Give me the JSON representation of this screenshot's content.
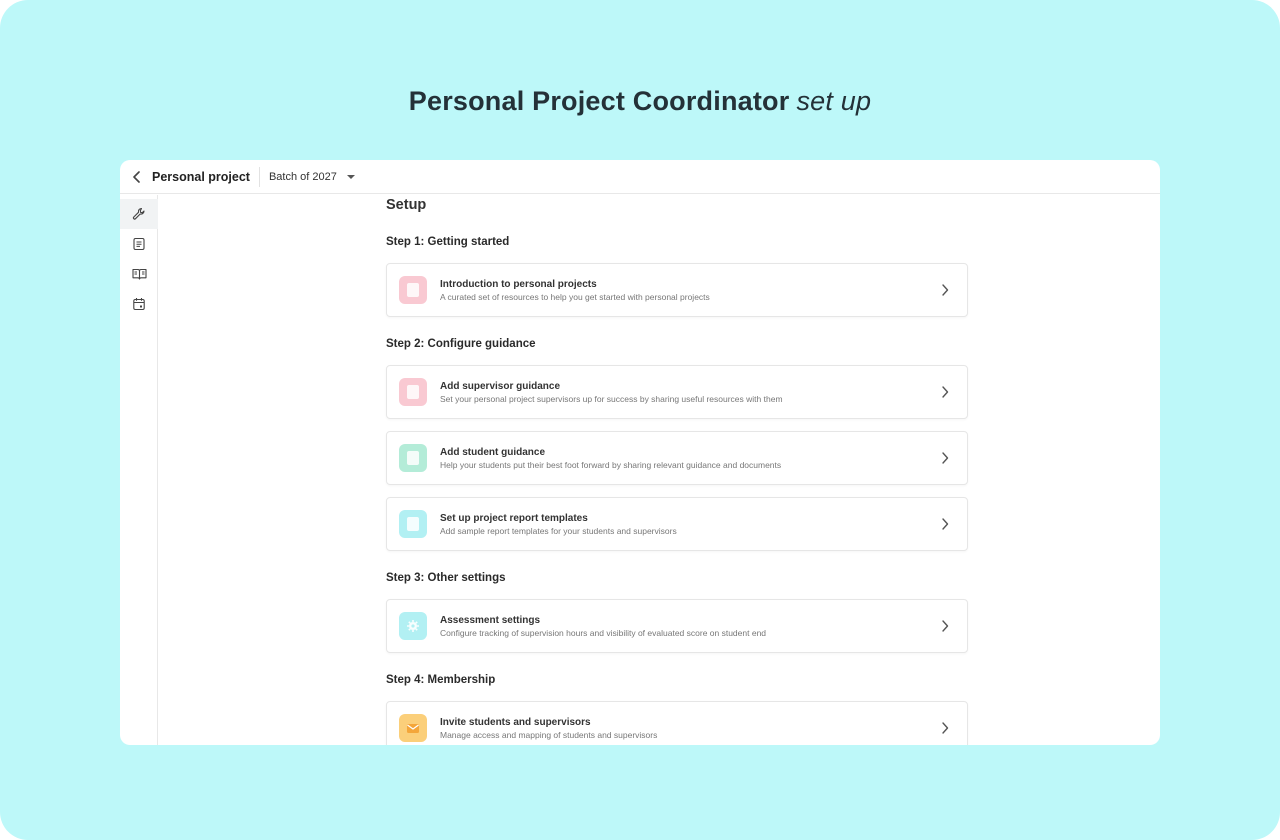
{
  "headline": {
    "strong": "Personal Project Coordinator",
    "soft": "set up"
  },
  "topbar": {
    "title": "Personal project",
    "batch": "Batch of 2027"
  },
  "colors": {
    "background": "#bdf8f9",
    "pink": "#f9c9d2",
    "teal": "#b4ecd8",
    "cyan": "#b2f0f3",
    "orange": "#fbcf7a"
  },
  "sidebar": [
    "wrench-icon",
    "document-list-icon",
    "book-icon",
    "calendar-icon"
  ],
  "setup": {
    "title": "Setup",
    "steps": [
      {
        "title": "Step 1: Getting started",
        "items": [
          {
            "title": "Introduction to personal projects",
            "desc": "A curated set of resources to help you get started with personal projects",
            "icon": "pink-document-icon"
          }
        ]
      },
      {
        "title": "Step 2: Configure guidance",
        "items": [
          {
            "title": "Add supervisor guidance",
            "desc": "Set your personal project supervisors up for success by sharing useful resources with them",
            "icon": "pink-document-icon"
          },
          {
            "title": "Add student guidance",
            "desc": "Help your students put their best foot forward by sharing relevant guidance and documents",
            "icon": "teal-document-icon"
          },
          {
            "title": "Set up project report templates",
            "desc": "Add sample report templates for your students and supervisors",
            "icon": "cyan-document-icon"
          }
        ]
      },
      {
        "title": "Step 3: Other settings",
        "items": [
          {
            "title": "Assessment settings",
            "desc": "Configure tracking of supervision hours and visibility of evaluated score on student end",
            "icon": "gear-icon"
          }
        ]
      },
      {
        "title": "Step 4: Membership",
        "items": [
          {
            "title": "Invite students and supervisors",
            "desc": "Manage access and mapping of students and supervisors",
            "icon": "envelope-icon"
          }
        ]
      }
    ]
  }
}
